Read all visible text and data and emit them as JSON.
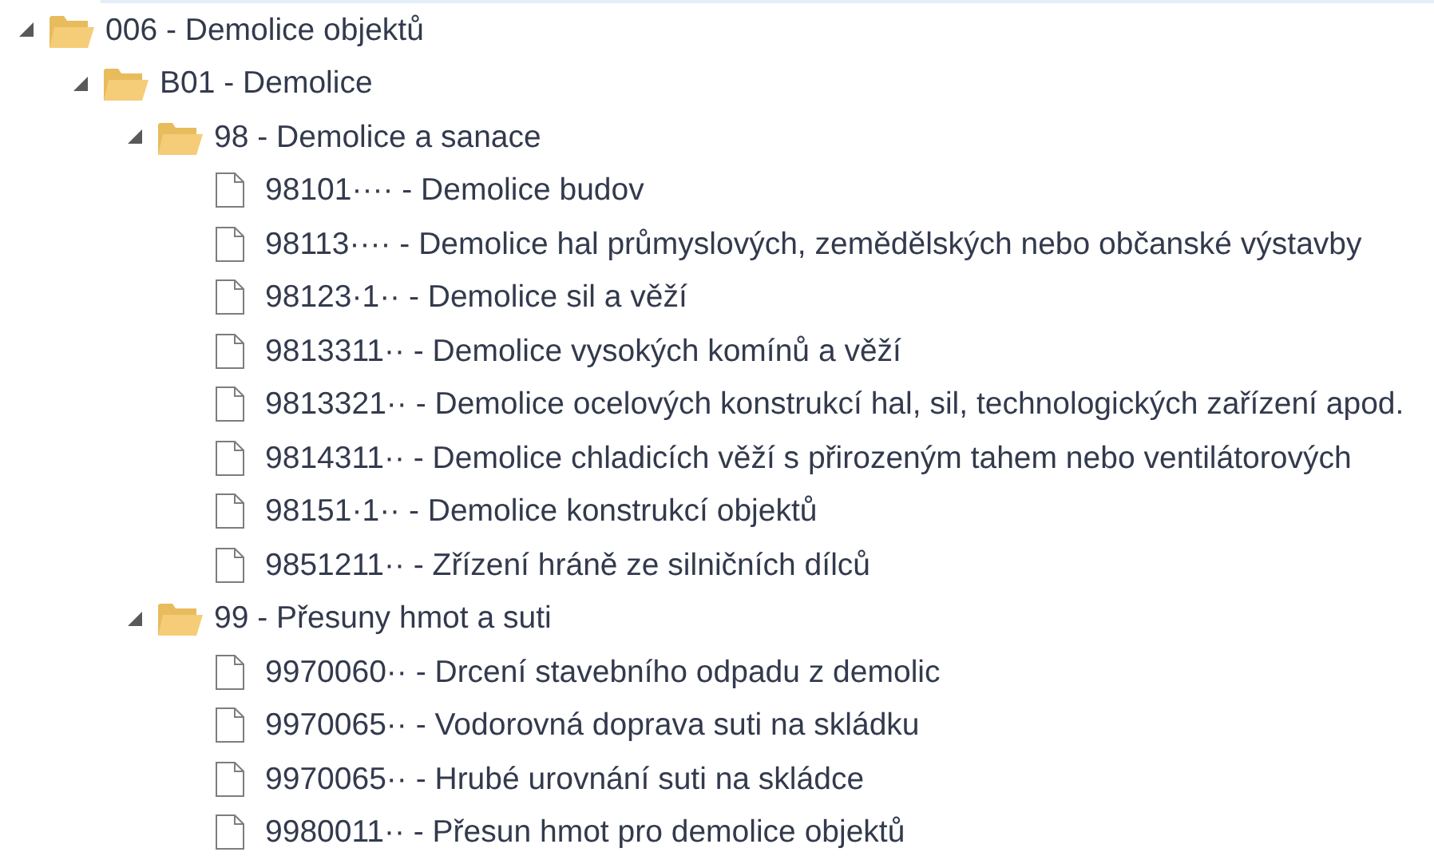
{
  "tree": [
    {
      "kind": "folder",
      "label": "006 - Demolice objektů",
      "expanded": true,
      "children": [
        {
          "kind": "folder",
          "label": "B01 - Demolice",
          "expanded": true,
          "children": [
            {
              "kind": "folder",
              "label": "98 - Demolice a sanace",
              "expanded": true,
              "children": [
                {
                  "kind": "file",
                  "label": "98101···· - Demolice budov"
                },
                {
                  "kind": "file",
                  "label": "98113···· - Demolice hal průmyslových, zemědělských nebo občanské výstavby"
                },
                {
                  "kind": "file",
                  "label": "98123·1·· - Demolice sil a věží"
                },
                {
                  "kind": "file",
                  "label": "9813311·· - Demolice vysokých komínů a věží"
                },
                {
                  "kind": "file",
                  "label": "9813321·· - Demolice ocelových konstrukcí hal, sil, technologických zařízení apod."
                },
                {
                  "kind": "file",
                  "label": "9814311·· - Demolice chladicích věží s přirozeným tahem nebo ventilátorových"
                },
                {
                  "kind": "file",
                  "label": "98151·1·· - Demolice konstrukcí objektů"
                },
                {
                  "kind": "file",
                  "label": "9851211·· - Zřízení hráně ze silničních dílců"
                }
              ]
            },
            {
              "kind": "folder",
              "label": "99 - Přesuny hmot a suti",
              "expanded": true,
              "children": [
                {
                  "kind": "file",
                  "label": "9970060·· - Drcení stavebního odpadu z demolic"
                },
                {
                  "kind": "file",
                  "label": "9970065·· - Vodorovná doprava suti na skládku"
                },
                {
                  "kind": "file",
                  "label": "9970065·· - Hrubé urovnání suti na skládce"
                },
                {
                  "kind": "file",
                  "label": "9980011·· - Přesun hmot pro demolice objektů"
                }
              ]
            }
          ]
        }
      ]
    }
  ]
}
